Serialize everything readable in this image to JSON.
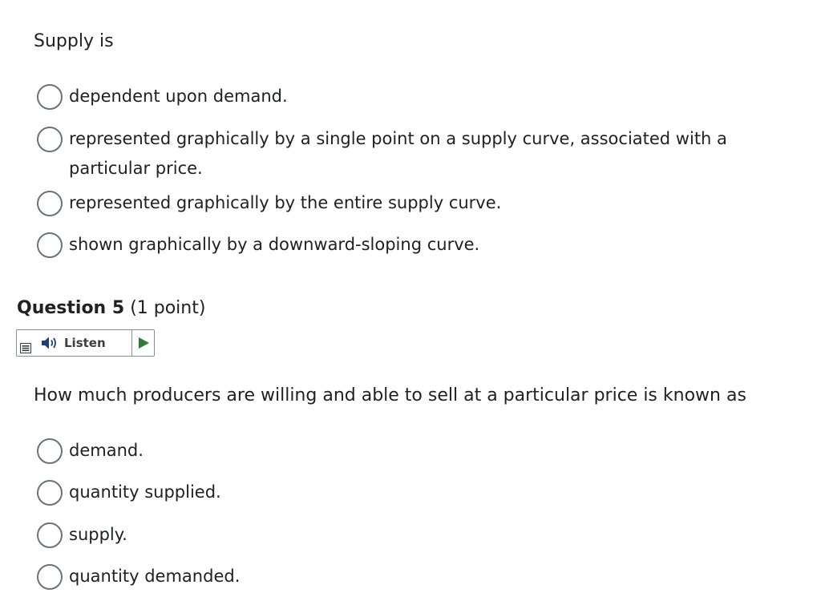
{
  "question4": {
    "prompt": "Supply is",
    "options": [
      "dependent upon demand.",
      "represented graphically by a single point on a supply curve, associated with a particular price.",
      "represented graphically by the entire supply curve.",
      "shown graphically by a downward-sloping curve."
    ]
  },
  "question5": {
    "title": "Question 5",
    "points": "(1 point)",
    "listen_label": "Listen",
    "prompt": "How much producers are willing and able to sell at a particular price is known as",
    "options": [
      "demand.",
      "quantity supplied.",
      "supply.",
      "quantity demanded."
    ]
  },
  "colors": {
    "text": "#202122",
    "radio_border": "#6e7276",
    "play_green": "#2e7d32",
    "speaker_blue": "#1f3f77"
  },
  "icons": {
    "listen_menu": "menu-icon",
    "speaker": "speaker-icon",
    "play": "play-icon"
  }
}
